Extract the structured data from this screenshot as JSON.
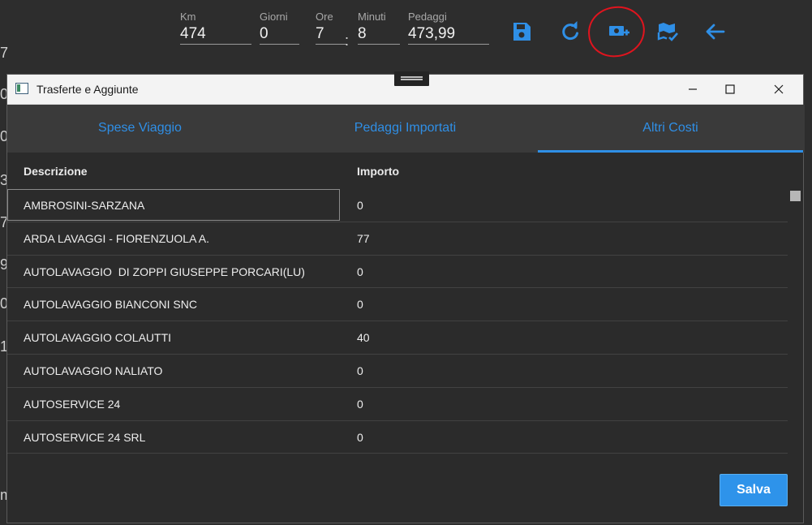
{
  "toolbar": {
    "fields": {
      "km": {
        "label": "Km",
        "value": "474"
      },
      "giorni": {
        "label": "Giorni",
        "value": "0"
      },
      "ore": {
        "label": "Ore",
        "value": "7"
      },
      "time_separator": ":",
      "minuti": {
        "label": "Minuti",
        "value": "8"
      },
      "pedaggi": {
        "label": "Pedaggi",
        "value": "473,99"
      }
    },
    "icons": [
      "save-icon",
      "refresh-icon",
      "add-expense-icon",
      "map-check-icon",
      "back-arrow-icon"
    ],
    "accent_color": "#2f8fe6",
    "annotation_color": "#e0141e"
  },
  "background_digits": [
    "7",
    "0",
    "0",
    "3",
    "7",
    "9",
    "0",
    "1",
    "m"
  ],
  "dialog": {
    "title": "Trasferte e Aggiunte",
    "tabs": [
      {
        "label": "Spese Viaggio",
        "active": false
      },
      {
        "label": "Pedaggi Importati",
        "active": false
      },
      {
        "label": "Altri Costi",
        "active": true
      }
    ],
    "table": {
      "columns": [
        "Descrizione",
        "Importo"
      ],
      "rows": [
        {
          "descrizione": "AMBROSINI-SARZANA",
          "importo": "0"
        },
        {
          "descrizione": "ARDA LAVAGGI - FIORENZUOLA A.",
          "importo": "77"
        },
        {
          "descrizione": "AUTOLAVAGGIO  DI ZOPPI GIUSEPPE PORCARI(LU)",
          "importo": "0"
        },
        {
          "descrizione": "AUTOLAVAGGIO BIANCONI SNC",
          "importo": "0"
        },
        {
          "descrizione": "AUTOLAVAGGIO COLAUTTI",
          "importo": "40"
        },
        {
          "descrizione": "AUTOLAVAGGIO NALIATO",
          "importo": "0"
        },
        {
          "descrizione": "AUTOSERVICE 24",
          "importo": "0"
        },
        {
          "descrizione": "AUTOSERVICE 24 SRL",
          "importo": "0"
        }
      ]
    },
    "save_label": "Salva"
  }
}
